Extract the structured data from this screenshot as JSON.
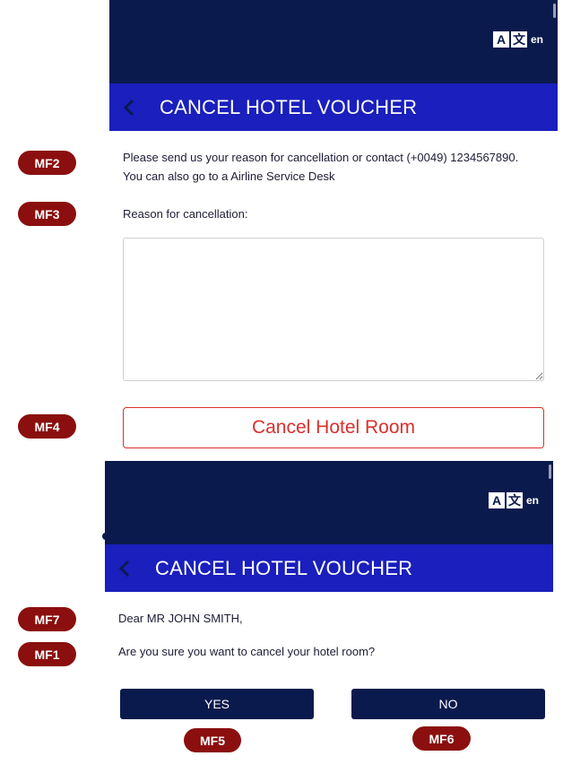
{
  "screen1": {
    "lang_code": "en",
    "lang_icon_a": "A",
    "lang_icon_b": "文",
    "title": "CANCEL HOTEL VOUCHER",
    "message": "Please send us your reason for cancellation or contact (+0049) 1234567890. You can also go to a Airline Service Desk",
    "reason_label": "Reason for cancellation:",
    "reason_value": "",
    "cancel_button": "Cancel Hotel Room"
  },
  "screen2": {
    "lang_code": "en",
    "lang_icon_a": "A",
    "lang_icon_b": "文",
    "title": "CANCEL HOTEL VOUCHER",
    "greeting": "Dear MR JOHN SMITH,",
    "question": "Are you sure you want to cancel your hotel room?",
    "yes_button": "YES",
    "no_button": "NO"
  },
  "markers": {
    "mf1": "MF1",
    "mf2": "MF2",
    "mf3": "MF3",
    "mf4": "MF4",
    "mf5": "MF5",
    "mf6": "MF6",
    "mf7": "MF7"
  },
  "colors": {
    "header_bg": "#0b1a4d",
    "titlebar_bg": "#1a1fbd",
    "marker_bg": "#8b0f0f",
    "cancel_accent": "#d9302b"
  }
}
